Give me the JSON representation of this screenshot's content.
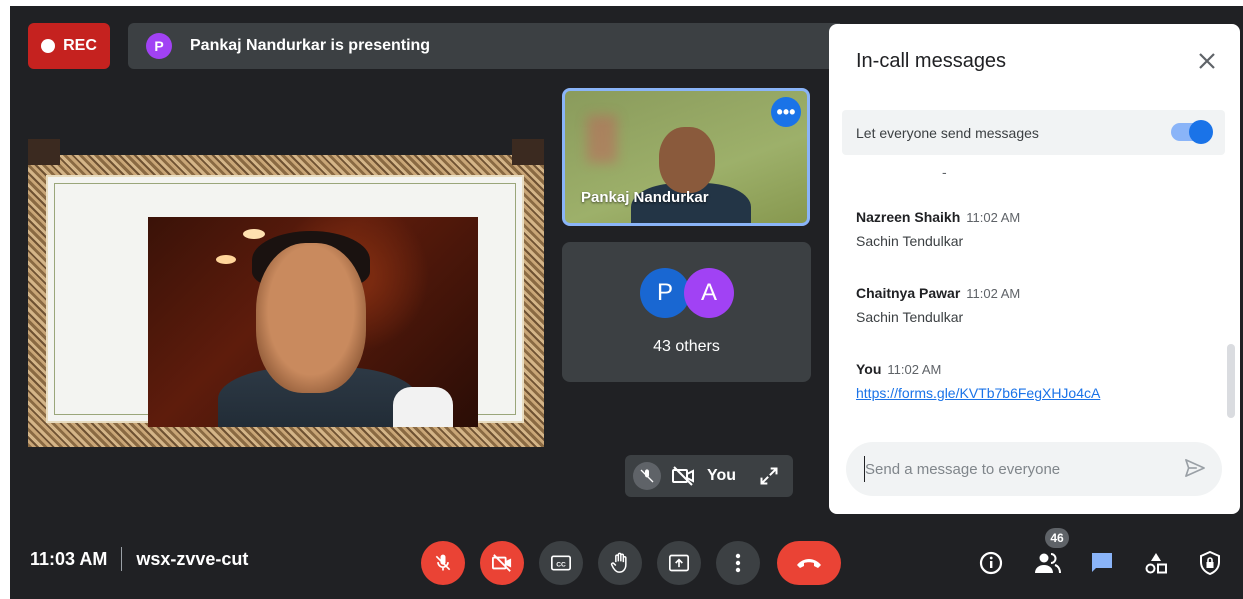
{
  "recording": {
    "label": "REC"
  },
  "presenting": {
    "avatar_initial": "P",
    "text": "Pankaj Nandurkar is presenting"
  },
  "tiles": {
    "camera": {
      "name": "Pankaj Nandurkar"
    },
    "others": {
      "initials": [
        "P",
        "A"
      ],
      "label": "43 others"
    },
    "self": {
      "label": "You"
    }
  },
  "chat": {
    "title": "In-call messages",
    "toggle_label": "Let everyone send messages",
    "toggle_on": true,
    "separator": "-",
    "messages": [
      {
        "sender": "Nazreen Shaikh",
        "time": "11:02 AM",
        "text": "Sachin Tendulkar"
      },
      {
        "sender": "Chaitnya Pawar",
        "time": "11:02 AM",
        "text": "Sachin Tendulkar"
      },
      {
        "sender": "You",
        "time": "11:02 AM",
        "link": "https://forms.gle/KVTb7b6FegXHJo4cA"
      }
    ],
    "input_placeholder": "Send a message to everyone"
  },
  "bottom_bar": {
    "time": "11:03 AM",
    "meeting_code": "wsx-zvve-cut",
    "participant_count": "46"
  },
  "icons": {
    "close": "close-icon",
    "send": "send-icon",
    "mic_off": "mic-off-icon",
    "camera_off": "camera-off-icon",
    "captions": "captions-icon",
    "hand": "raise-hand-icon",
    "present": "present-icon",
    "more": "more-vert-icon",
    "end_call": "end-call-icon",
    "info": "info-icon",
    "people": "people-icon",
    "chat": "chat-icon",
    "activities": "activities-icon",
    "host_controls": "host-controls-icon"
  },
  "colors": {
    "background": "#202124",
    "accent": "#1a73e8",
    "danger": "#ea4335",
    "tile": "#3c4043"
  }
}
